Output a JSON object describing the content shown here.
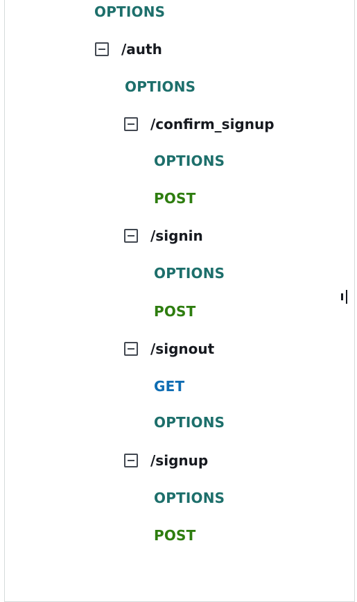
{
  "tree": {
    "root_method": "OPTIONS",
    "auth": {
      "path": "/auth",
      "method": "OPTIONS",
      "confirm_signup": {
        "path": "/confirm_signup",
        "methods": [
          "OPTIONS",
          "POST"
        ]
      },
      "signin": {
        "path": "/signin",
        "methods": [
          "OPTIONS",
          "POST"
        ]
      },
      "signout": {
        "path": "/signout",
        "methods": [
          "GET",
          "OPTIONS"
        ]
      },
      "signup": {
        "path": "/signup",
        "methods": [
          "OPTIONS",
          "POST"
        ]
      }
    }
  },
  "icons": {
    "collapse": "collapse-minus-icon",
    "resize": "resize-handle-icon"
  },
  "colors": {
    "options": "#1d6f6b",
    "post": "#2e7d0f",
    "get": "#0f6db3",
    "path_text": "#16191f"
  }
}
